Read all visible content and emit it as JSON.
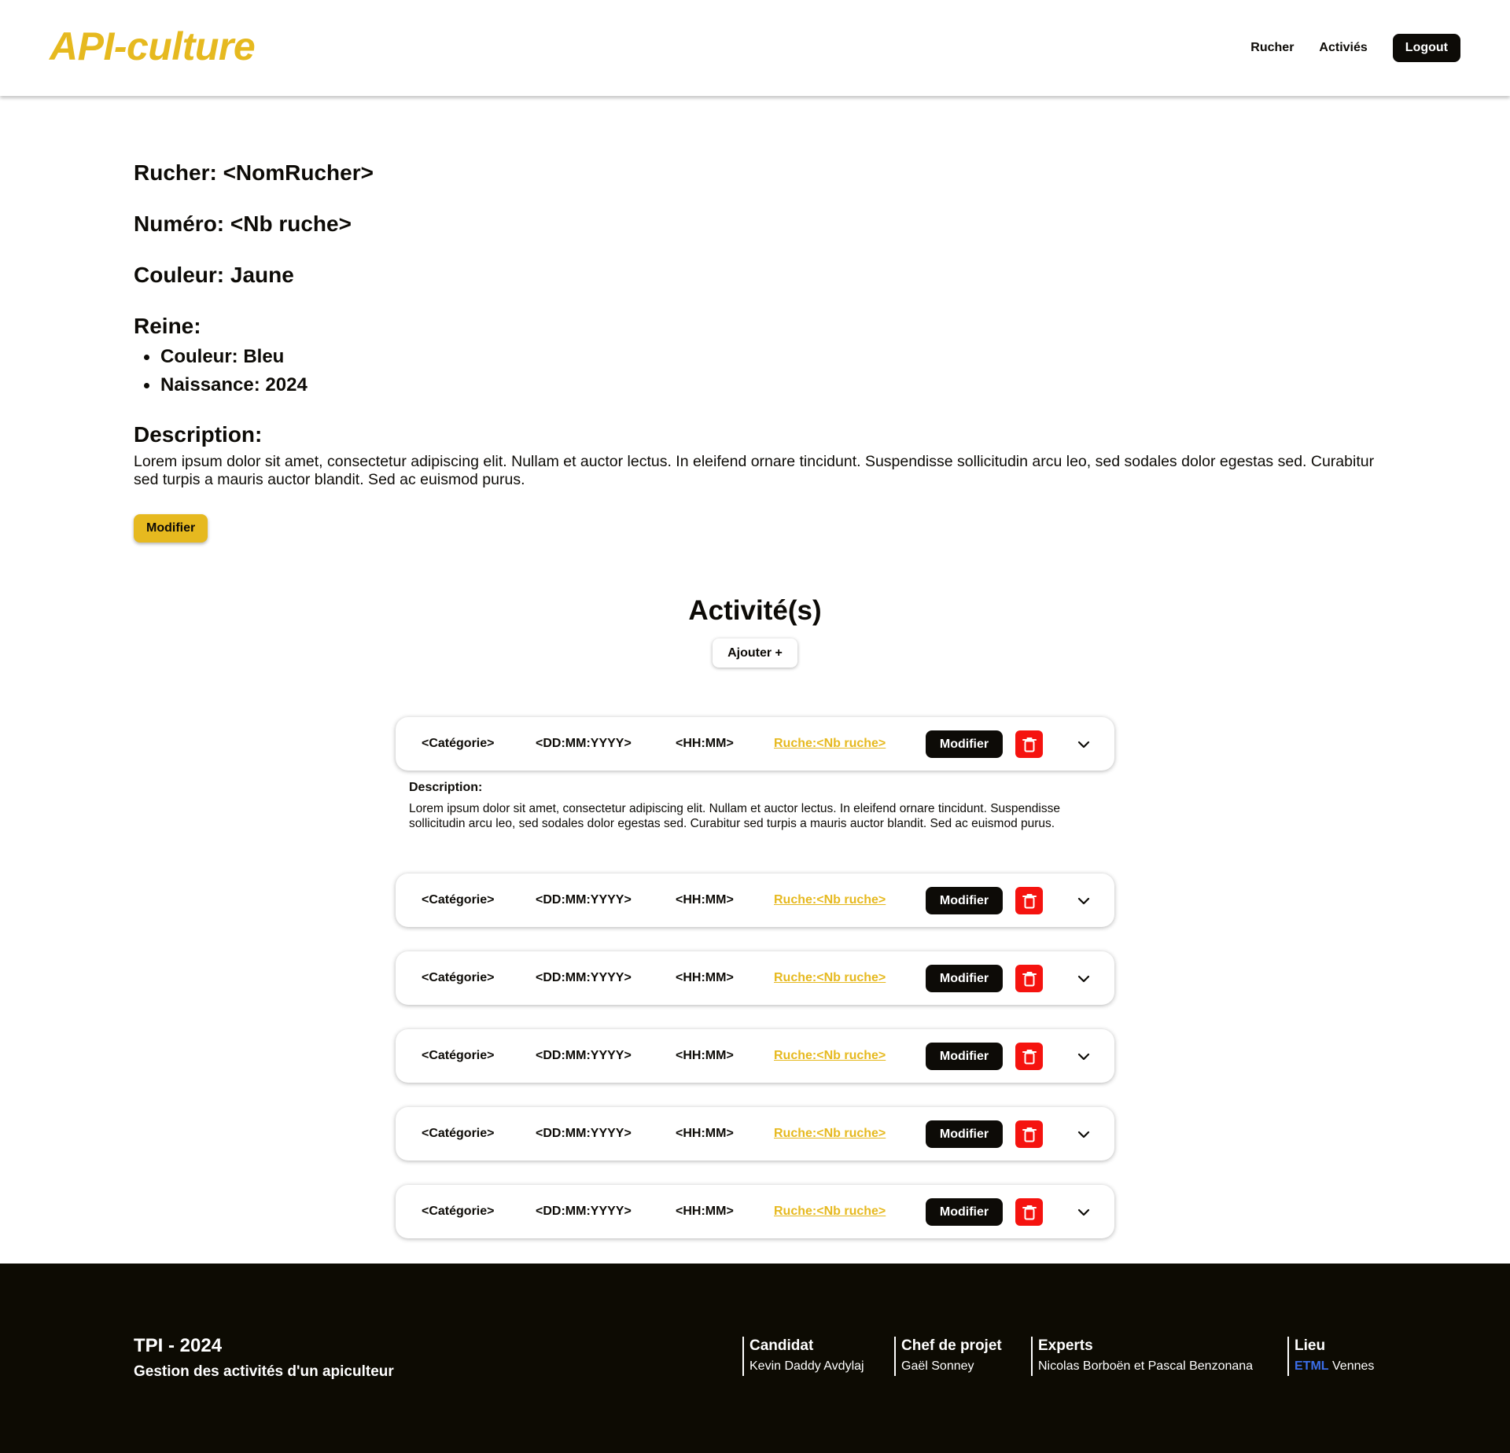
{
  "header": {
    "logo": "API-culture",
    "nav": {
      "rucher": "Rucher",
      "activites": "Activiés",
      "logout": "Logout"
    }
  },
  "info": {
    "rucher": "Rucher: <NomRucher>",
    "numero": "Numéro: <Nb ruche>",
    "couleur": "Couleur: Jaune",
    "reine_title": "Reine:",
    "reine_items": [
      "Couleur: Bleu",
      "Naissance: 2024"
    ],
    "description_title": "Description:",
    "description": "Lorem ipsum dolor sit amet, consectetur adipiscing elit. Nullam et  auctor lectus. In eleifend ornare tincidunt. Suspendisse sollicitudin  arcu leo, sed sodales dolor egestas sed. Curabitur sed turpis a mauris  auctor blandit. Sed ac euismod purus.",
    "modifier_label": "Modifier"
  },
  "activities": {
    "title": "Activité(s)",
    "add_label": "Ajouter +",
    "items": [
      {
        "categorie": "<Catégorie>",
        "date": "<DD:MM:YYYY>",
        "heure": "<HH:MM>",
        "ruche": "Ruche:<Nb ruche>",
        "modifier": "Modifier",
        "expanded": true
      },
      {
        "categorie": "<Catégorie>",
        "date": "<DD:MM:YYYY>",
        "heure": "<HH:MM>",
        "ruche": "Ruche:<Nb ruche>",
        "modifier": "Modifier",
        "expanded": false
      },
      {
        "categorie": "<Catégorie>",
        "date": "<DD:MM:YYYY>",
        "heure": "<HH:MM>",
        "ruche": "Ruche:<Nb ruche>",
        "modifier": "Modifier",
        "expanded": false
      },
      {
        "categorie": "<Catégorie>",
        "date": "<DD:MM:YYYY>",
        "heure": "<HH:MM>",
        "ruche": "Ruche:<Nb ruche>",
        "modifier": "Modifier",
        "expanded": false
      },
      {
        "categorie": "<Catégorie>",
        "date": "<DD:MM:YYYY>",
        "heure": "<HH:MM>",
        "ruche": "Ruche:<Nb ruche>",
        "modifier": "Modifier",
        "expanded": false
      },
      {
        "categorie": "<Catégorie>",
        "date": "<DD:MM:YYYY>",
        "heure": "<HH:MM>",
        "ruche": "Ruche:<Nb ruche>",
        "modifier": "Modifier",
        "expanded": false
      }
    ],
    "expanded_description_label": "Description:",
    "expanded_description": "Lorem ipsum dolor sit amet, consectetur adipiscing elit. Nullam et  auctor lectus. In eleifend ornare tincidunt. Suspendisse sollicitudin  arcu leo, sed sodales dolor egestas sed. Curabitur sed turpis a mauris  auctor blandit. Sed ac euismod purus."
  },
  "footer": {
    "title": "TPI - 2024",
    "subtitle": "Gestion des activités d'un apiculteur",
    "candidat_label": "Candidat",
    "candidat": "Kevin Daddy Avdylaj",
    "chef_label": "Chef de projet",
    "chef": "Gaël Sonney",
    "experts_label": "Experts",
    "experts": "Nicolas Borboën et Pascal Benzonana",
    "lieu_label": "Lieu",
    "lieu_school": "ETML",
    "lieu_city": "Vennes"
  },
  "colors": {
    "accent_yellow": "#e6b91f",
    "dark": "#0d0b07",
    "delete_red": "#f5130f",
    "link_blue": "#3b6ee8"
  },
  "icons": [
    "trash-icon",
    "chevron-down-icon"
  ]
}
